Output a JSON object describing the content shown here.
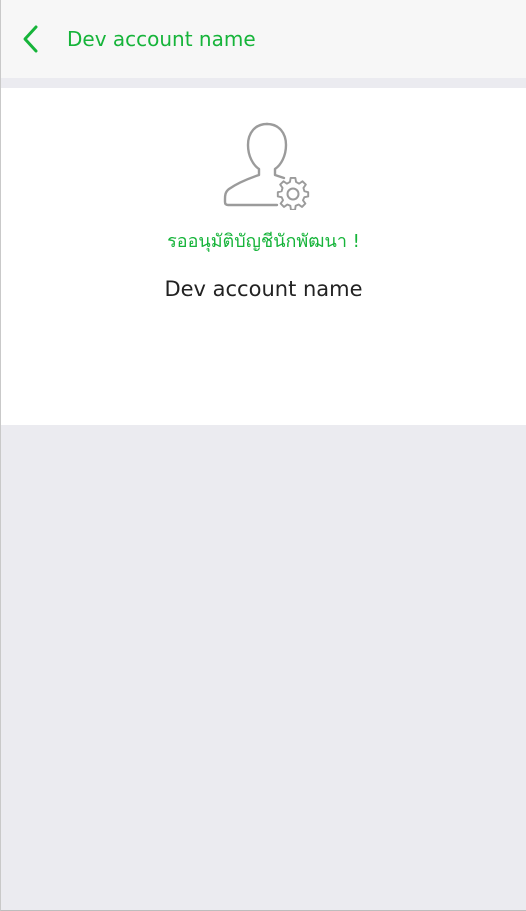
{
  "header": {
    "back_icon": "chevron-left-icon",
    "title": "Dev account name"
  },
  "content": {
    "avatar_icon": "user-settings-icon",
    "status_text": "รออนุมัติบัญชีนักพัฒนา !",
    "account_name": "Dev account name"
  },
  "colors": {
    "accent": "#16b43a",
    "header_bg": "#f7f7f7",
    "page_bg": "#ebebf0",
    "card_bg": "#ffffff",
    "text": "#222222",
    "icon_gray": "#9b9b9b"
  }
}
